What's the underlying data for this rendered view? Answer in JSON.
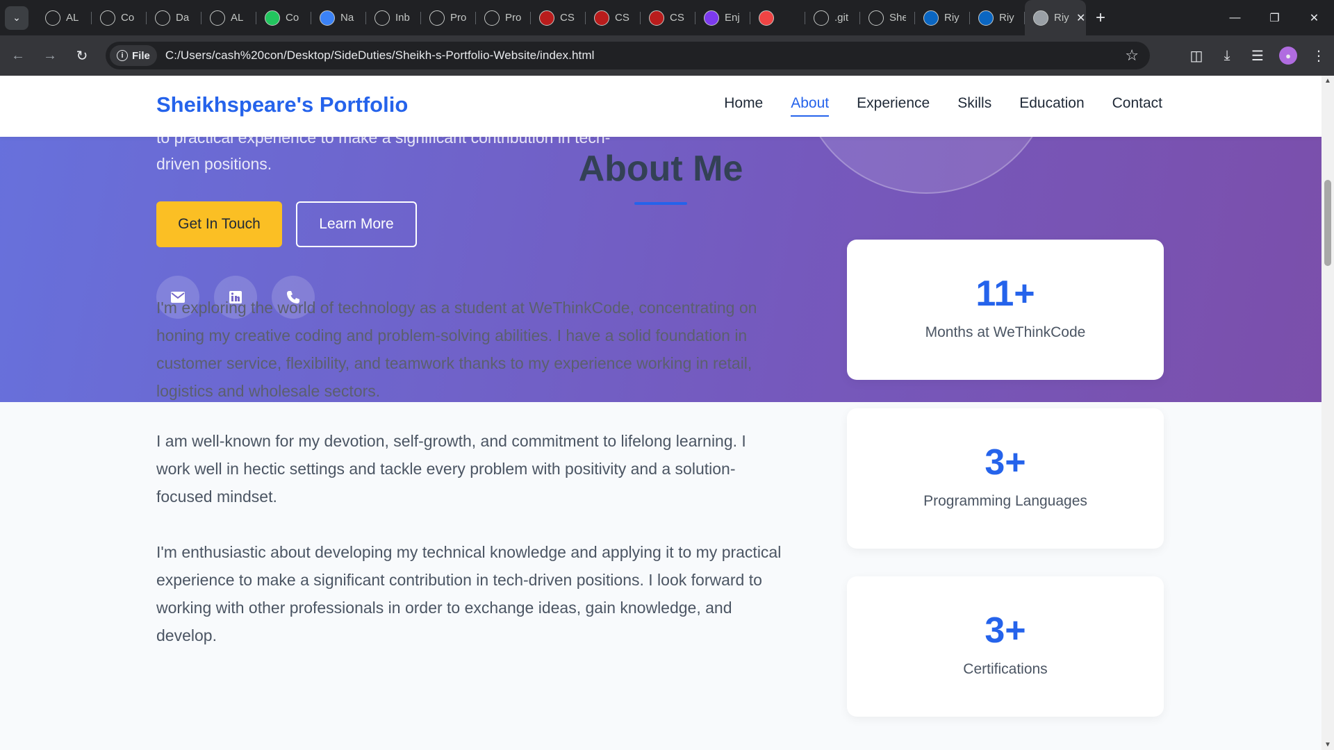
{
  "browser": {
    "tabs": [
      {
        "label": "AL",
        "icon": "ai-icon",
        "color": "#202124"
      },
      {
        "label": "Co",
        "icon": "loading-icon",
        "color": "#202124"
      },
      {
        "label": "Da",
        "icon": "chatgpt-icon",
        "color": "#202124"
      },
      {
        "label": "AL",
        "icon": "google-drive-icon",
        "color": "#202124"
      },
      {
        "label": "Co",
        "icon": "plus-circle-icon",
        "color": "#22c55e"
      },
      {
        "label": "Na",
        "icon": "globe-icon",
        "color": "#3b82f6"
      },
      {
        "label": "Inb",
        "icon": "gmail-icon",
        "color": "#202124"
      },
      {
        "label": "Pro",
        "icon": "loading-icon",
        "color": "#202124"
      },
      {
        "label": "Pro",
        "icon": "loading-icon",
        "color": "#202124"
      },
      {
        "label": "CS",
        "icon": "shield-icon",
        "color": "#b91c1c"
      },
      {
        "label": "CS",
        "icon": "shield-icon",
        "color": "#b91c1c"
      },
      {
        "label": "CS",
        "icon": "shield-icon",
        "color": "#b91c1c"
      },
      {
        "label": "Enj",
        "icon": "gradient-icon",
        "color": "#7c3aed"
      },
      {
        "label": "",
        "icon": "youtube-icon",
        "color": "#ef4444"
      },
      {
        "label": ".git",
        "icon": "chatgpt-icon",
        "color": "#202124"
      },
      {
        "label": "She",
        "icon": "github-icon",
        "color": "#202124"
      },
      {
        "label": "Riy",
        "icon": "linkedin-icon",
        "color": "#0a66c2"
      },
      {
        "label": "Riy",
        "icon": "linkedin-icon",
        "color": "#0a66c2"
      },
      {
        "label": "Riy",
        "icon": "globe-icon",
        "color": "#9aa0a6"
      }
    ],
    "file_chip": "File",
    "url": "C:/Users/cash%20con/Desktop/SideDuties/Sheikh-s-Portfolio-Website/index.html"
  },
  "header": {
    "logo": "Sheikhspeare's Portfolio",
    "nav": [
      "Home",
      "About",
      "Experience",
      "Skills",
      "Education",
      "Contact"
    ],
    "active_nav": "About"
  },
  "hero": {
    "text_line1": "to practical experience to make a significant contribution in tech-",
    "text_line2": "driven positions.",
    "primary_button": "Get In Touch",
    "secondary_button": "Learn More"
  },
  "about": {
    "title": "About Me",
    "paragraphs": [
      "I'm exploring the world of technology as a student at WeThinkCode, concentrating on honing my creative coding and problem-solving abilities. I have a solid foundation in customer service, flexibility, and teamwork thanks to my experience working in retail, logistics and wholesale sectors.",
      "I am well-known for my devotion, self-growth, and commitment to lifelong learning. I work well in hectic settings and tackle every problem with positivity and a solution-focused mindset.",
      "I'm enthusiastic about developing my technical knowledge and applying it to my practical experience to make a significant contribution in tech-driven positions. I look forward to working with other professionals in order to exchange ideas, gain knowledge, and develop."
    ],
    "stats": [
      {
        "value": "11+",
        "label": "Months at WeThinkCode"
      },
      {
        "value": "3+",
        "label": "Programming Languages"
      },
      {
        "value": "3+",
        "label": "Certifications"
      }
    ]
  },
  "colors": {
    "accent": "#2563eb",
    "button_yellow": "#fbbf24",
    "hero_gradient_start": "#6771dc",
    "hero_gradient_end": "#7b4fab"
  }
}
